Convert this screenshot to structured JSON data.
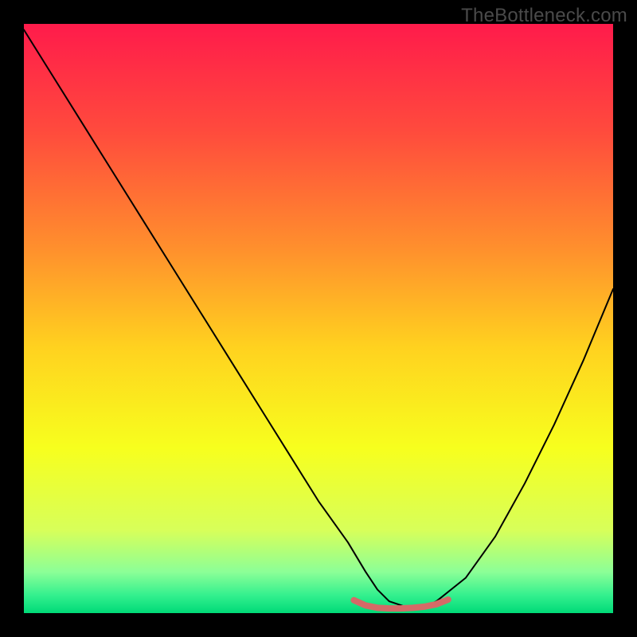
{
  "watermark": "TheBottleneck.com",
  "chart_data": {
    "type": "line",
    "title": "",
    "xlabel": "",
    "ylabel": "",
    "xlim": [
      0,
      100
    ],
    "ylim": [
      0,
      100
    ],
    "grid": false,
    "legend": false,
    "background": {
      "kind": "vertical-gradient",
      "stops": [
        {
          "pos": 0.0,
          "color": "#ff1b4b"
        },
        {
          "pos": 0.18,
          "color": "#ff4a3d"
        },
        {
          "pos": 0.38,
          "color": "#ff8f2d"
        },
        {
          "pos": 0.55,
          "color": "#ffd21f"
        },
        {
          "pos": 0.72,
          "color": "#f7ff1e"
        },
        {
          "pos": 0.86,
          "color": "#d7ff5a"
        },
        {
          "pos": 0.93,
          "color": "#8cff97"
        },
        {
          "pos": 0.97,
          "color": "#33f08e"
        },
        {
          "pos": 1.0,
          "color": "#00d977"
        }
      ]
    },
    "series": [
      {
        "name": "bottleneck-curve",
        "color": "#000000",
        "width": 2,
        "x": [
          0,
          5,
          10,
          15,
          20,
          25,
          30,
          35,
          40,
          45,
          50,
          55,
          58,
          60,
          62,
          65,
          68,
          70,
          75,
          80,
          85,
          90,
          95,
          100
        ],
        "y": [
          99,
          91,
          83,
          75,
          67,
          59,
          51,
          43,
          35,
          27,
          19,
          12,
          7,
          4,
          2,
          1,
          1,
          2,
          6,
          13,
          22,
          32,
          43,
          55
        ]
      },
      {
        "name": "safe-zone-bottom",
        "color": "#d46a67",
        "width": 8,
        "x": [
          56,
          58,
          60,
          62,
          64,
          66,
          68,
          70,
          72
        ],
        "y": [
          2.2,
          1.3,
          0.9,
          0.8,
          0.8,
          0.9,
          1.1,
          1.5,
          2.3
        ]
      }
    ]
  },
  "colors": {
    "frame": "#000000",
    "curve": "#000000",
    "safe_zone": "#d46a67",
    "watermark": "#4a4a4a"
  }
}
